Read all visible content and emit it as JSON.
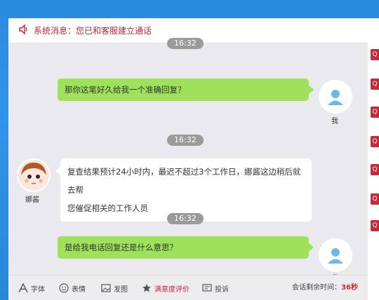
{
  "system": {
    "label": "系统消息：您已和客服建立通话"
  },
  "messages": [
    {
      "time": "16:32",
      "from": "me",
      "text": "那你这笔好久给我一个准确回复？",
      "name": "我"
    },
    {
      "time": "16:32",
      "from": "agent",
      "lines": [
        "复查结果预计24小时内，最迟不超过3个工作日，娜酱这边稍后就去帮",
        "您催促相关的工作人员"
      ],
      "name": "娜酱"
    },
    {
      "time": "16:32",
      "from": "me",
      "text": "是给我电话回复还是什么意思？",
      "name": "我"
    }
  ],
  "toolbar": {
    "font": "字体",
    "emoji": "表情",
    "image": "发图",
    "rating": "满意度评价",
    "complain": "投诉",
    "timer_label": "会话剩余时间：",
    "timer_value": "36秒"
  },
  "side_tabs": [
    "Q",
    "Q",
    "Q",
    "Q",
    "Q",
    "Q",
    "Q"
  ],
  "colors": {
    "accent": "#c8283a",
    "my_bubble": "#9ee15a",
    "background": "#e9e9ee"
  }
}
